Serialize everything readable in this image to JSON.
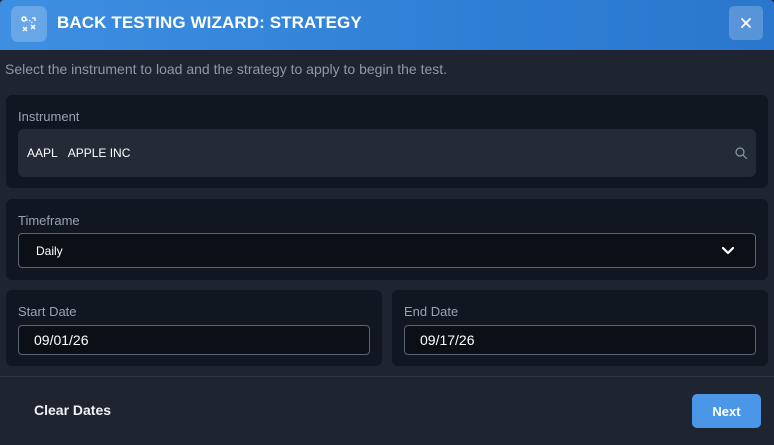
{
  "header": {
    "title": "BACK TESTING WIZARD: STRATEGY",
    "icon": "strategy-icon",
    "close_icon": "close-icon"
  },
  "subtitle": "Select the instrument to load and the strategy to apply to begin the test.",
  "instrument": {
    "label": "Instrument",
    "symbol": "AAPL",
    "name": "APPLE INC",
    "icon": "search-icon"
  },
  "timeframe": {
    "label": "Timeframe",
    "value": "Daily",
    "icon": "chevron-down-icon"
  },
  "start_date": {
    "label": "Start Date",
    "value": "09/01/26"
  },
  "end_date": {
    "label": "End Date",
    "value": "09/17/26"
  },
  "footer": {
    "clear_label": "Clear Dates",
    "next_label": "Next"
  },
  "colors": {
    "header_accent": "#2f7fd6",
    "primary_button": "#4a97e8",
    "background": "#1e2530",
    "panel": "#111720"
  }
}
